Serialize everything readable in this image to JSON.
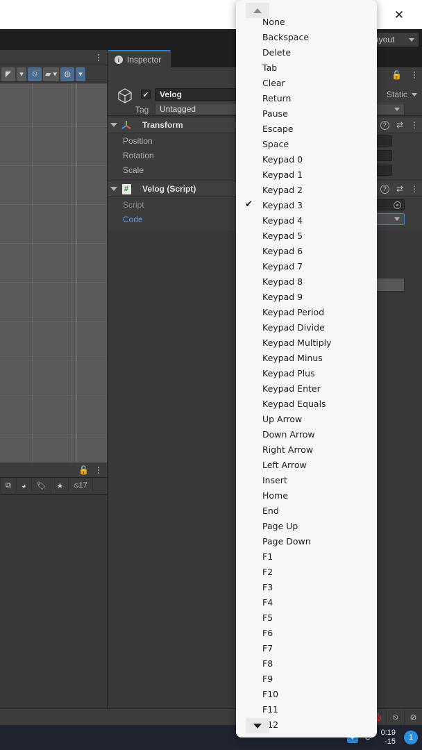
{
  "window": {
    "close_label": "✕"
  },
  "unity": {
    "layout_dropdown": "ayout",
    "scene": {
      "tab_kebab": "⋮",
      "toolbar": [
        {
          "name": "shading-mode-button",
          "label": "◤",
          "active": false
        },
        {
          "name": "shading-mode-dropdown",
          "label": "▾",
          "active": false
        },
        {
          "name": "scene-visibility-toggle",
          "label": "⦸",
          "active": true
        },
        {
          "name": "camera-settings-button",
          "label": "▰",
          "active": false
        },
        {
          "name": "camera-settings-dropdown",
          "label": "▾",
          "active": false
        },
        {
          "name": "gizmos-toggle",
          "label": "◍",
          "active": true
        },
        {
          "name": "gizmos-dropdown",
          "label": "▾",
          "active": true
        }
      ]
    },
    "project": {
      "lock_icon": "🔓",
      "kebab": "⋮",
      "tools": [
        {
          "name": "open-prefab-button",
          "label": "⧉"
        },
        {
          "name": "asset-filter-button",
          "label": "◕"
        },
        {
          "name": "label-filter-button",
          "label": "🏷"
        },
        {
          "name": "favorites-filter-button",
          "label": "★"
        },
        {
          "name": "hidden-count",
          "label": "⦸17"
        }
      ]
    },
    "inspector": {
      "tab_label": "Inspector",
      "info_icon": "i",
      "lock_icon": "🔓",
      "kebab": "⋮",
      "gameobject": {
        "enabled_check": "✔",
        "name": "Velog",
        "static_label": "Static",
        "tag_label": "Tag",
        "tag_value": "Untagged"
      },
      "components": [
        {
          "name": "Transform",
          "icon": "⁙",
          "help": "?",
          "preset": "⇄",
          "kebab": "⋮",
          "properties": [
            {
              "label": "Position",
              "type": "vector"
            },
            {
              "label": "Rotation",
              "type": "vector"
            },
            {
              "label": "Scale",
              "type": "vector",
              "extra": "⦸"
            }
          ]
        },
        {
          "name": "Velog (Script)",
          "icon": "#",
          "help": "?",
          "preset": "⇄",
          "kebab": "⋮",
          "properties": [
            {
              "label": "Script",
              "type": "object",
              "disabled": true
            },
            {
              "label": "Code",
              "type": "enum",
              "link": true
            }
          ]
        }
      ],
      "add_component_label": ""
    },
    "statusbar": {
      "icons": [
        {
          "name": "bug-icon",
          "label": "🐞"
        },
        {
          "name": "mute-audio-icon",
          "label": "⦸"
        },
        {
          "name": "status-ok-icon",
          "label": "⊘"
        }
      ]
    }
  },
  "dropdown": {
    "scroll_up": "▲",
    "scroll_down": "▼",
    "selected": "Keypad 3",
    "check_glyph": "✔",
    "items": [
      "None",
      "Backspace",
      "Delete",
      "Tab",
      "Clear",
      "Return",
      "Pause",
      "Escape",
      "Space",
      "Keypad 0",
      "Keypad 1",
      "Keypad 2",
      "Keypad 3",
      "Keypad 4",
      "Keypad 5",
      "Keypad 6",
      "Keypad 7",
      "Keypad 8",
      "Keypad 9",
      "Keypad Period",
      "Keypad Divide",
      "Keypad Multiply",
      "Keypad Minus",
      "Keypad Plus",
      "Keypad Enter",
      "Keypad Equals",
      "Up Arrow",
      "Down Arrow",
      "Right Arrow",
      "Left Arrow",
      "Insert",
      "Home",
      "End",
      "Page Up",
      "Page Down",
      "F1",
      "F2",
      "F3",
      "F4",
      "F5",
      "F6",
      "F7",
      "F8",
      "F9",
      "F10",
      "F11",
      "F12"
    ]
  },
  "taskbar": {
    "chevron": "⌃",
    "bluetooth": "✦",
    "sync": "⟳",
    "time": "0:19",
    "date": "-15",
    "notification_count": "1"
  },
  "colors": {
    "accent": "#3b7fd4",
    "panel": "#383838",
    "toolbar": "#3c3c3c",
    "menu_bg": "#f7f7f7"
  }
}
